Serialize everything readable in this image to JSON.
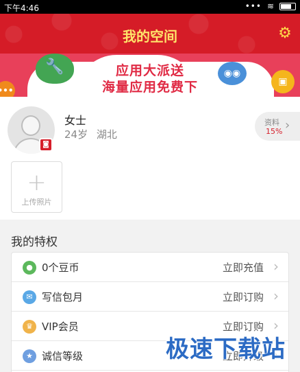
{
  "statusbar": {
    "time": "下午4:46",
    "dots": "•••"
  },
  "header": {
    "title": "我的空间"
  },
  "banner": {
    "line1": "应用大派送",
    "line2": "海量应用免费下"
  },
  "profile": {
    "name": "女士",
    "age": "24岁",
    "region": "湖北",
    "data_label": "资料",
    "data_percent": "15%",
    "upload_label": "上传照片"
  },
  "privileges": {
    "title": "我的特权",
    "items": [
      {
        "label": "0个豆币",
        "action": "立即充值",
        "icon": "bean-icon",
        "color": "#5cb85c"
      },
      {
        "label": "写信包月",
        "action": "立即订购",
        "icon": "mail-icon",
        "color": "#5aa8e6"
      },
      {
        "label": "VIP会员",
        "action": "立即订购",
        "icon": "crown-icon",
        "color": "#f0b34a"
      },
      {
        "label": "诚信等级",
        "action": "立即升级",
        "icon": "star-icon",
        "color": "#6f9fe0"
      }
    ]
  },
  "watermark": "极速下载站"
}
